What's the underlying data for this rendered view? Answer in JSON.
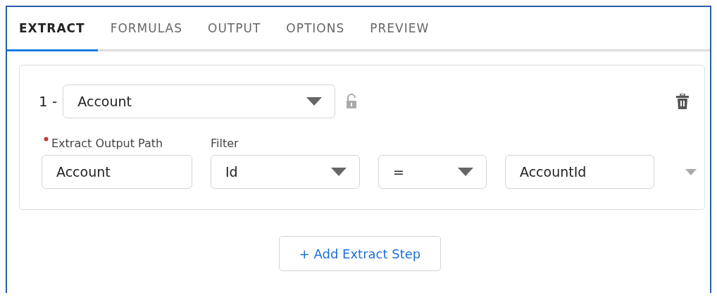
{
  "tabs": [
    {
      "label": "EXTRACT",
      "selected": true
    },
    {
      "label": "FORMULAS",
      "selected": false
    },
    {
      "label": "OUTPUT",
      "selected": false
    },
    {
      "label": "OPTIONS",
      "selected": false
    },
    {
      "label": "PREVIEW",
      "selected": false
    }
  ],
  "step": {
    "number": "1 -",
    "object_select": {
      "value": "Account"
    },
    "output_path": {
      "label": "Extract Output Path",
      "required": true,
      "value": "Account"
    },
    "filter": {
      "label": "Filter",
      "field_select": {
        "value": "Id"
      },
      "operator_select": {
        "value": "="
      },
      "value_field": {
        "value": "AccountId"
      }
    }
  },
  "add_button": {
    "label": "+ Add Extract Step"
  }
}
